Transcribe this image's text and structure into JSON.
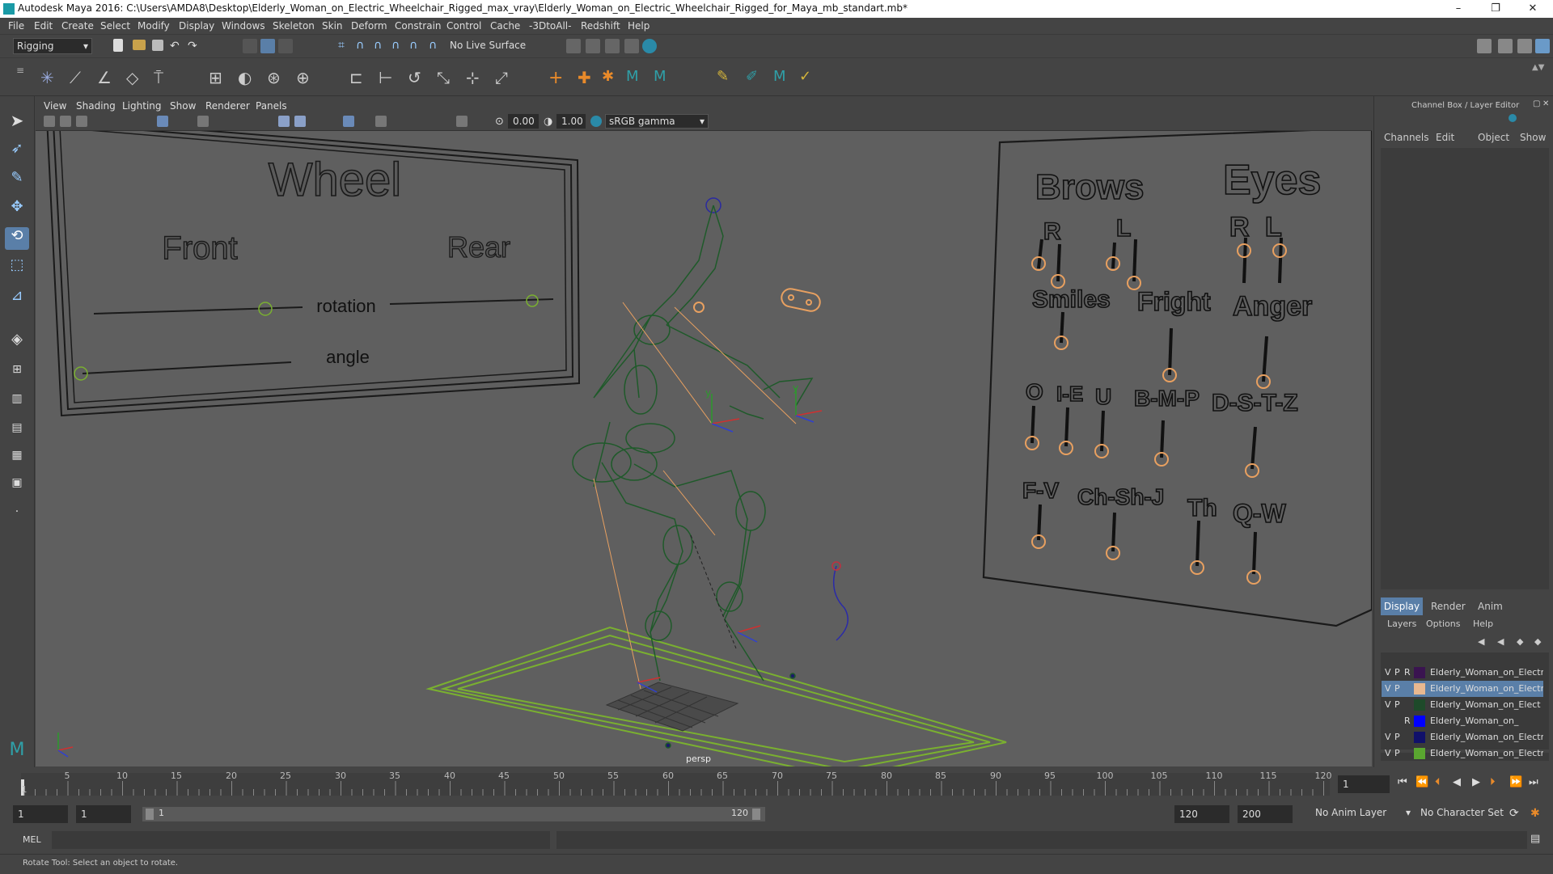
{
  "window": {
    "title": "Autodesk Maya 2016: C:\\Users\\AMDA8\\Desktop\\Elderly_Woman_on_Electric_Wheelchair_Rigged_max_vray\\Elderly_Woman_on_Electric_Wheelchair_Rigged_for_Maya_mb_standart.mb*",
    "minimize": "–",
    "restore": "❐",
    "close": "✕"
  },
  "menu": [
    "File",
    "Edit",
    "Create",
    "Select",
    "Modify",
    "Display",
    "Windows",
    "Skeleton",
    "Skin",
    "Deform",
    "Constrain",
    "Control",
    "Cache",
    "-3DtoAll-",
    "Redshift",
    "Help"
  ],
  "shelf": {
    "mode": "Rigging",
    "live_surface": "No Live Surface"
  },
  "panel_menu": [
    "View",
    "Shading",
    "Lighting",
    "Show",
    "Renderer",
    "Panels"
  ],
  "panel_toolbar": {
    "value_a": "0.00",
    "value_b": "1.00",
    "color_space": "sRGB gamma"
  },
  "viewport": {
    "camera": "persp",
    "wheel_board": {
      "title": "Wheel",
      "front": "Front",
      "rear": "Rear",
      "rotation": "rotation",
      "angle": "angle"
    },
    "face_board": {
      "brows": "Brows",
      "eyes": "Eyes",
      "brows_r": "R",
      "brows_l": "L",
      "eyes_r": "R",
      "eyes_l": "L",
      "smiles": "Smiles",
      "fright": "Fright",
      "anger": "Anger",
      "o": "O",
      "ie": "I-E",
      "u": "U",
      "bmp": "B-M-P",
      "dstz": "D-S-T-Z",
      "fv": "F-V",
      "chshj": "Ch-Sh-J",
      "th": "Th",
      "qw": "Q-W"
    }
  },
  "channel_box": {
    "header": "Channel Box / Layer Editor",
    "menu": [
      "Channels",
      "Edit",
      "Object",
      "Show"
    ],
    "tabs": [
      "Display",
      "Render",
      "Anim"
    ],
    "layer_menu": [
      "Layers",
      "Options",
      "Help"
    ],
    "layers": [
      {
        "v": "V",
        "p": "P",
        "r": "R",
        "color": "#3a1450",
        "name": "Elderly_Woman_on_Electri"
      },
      {
        "v": "V",
        "p": "P",
        "r": "",
        "color": "#e8b890",
        "name": "Elderly_Woman_on_Electri",
        "selected": true
      },
      {
        "v": "V",
        "p": "P",
        "r": "",
        "color": "#1e4a2a",
        "name": "Elderly_Woman_on_Elect"
      },
      {
        "v": "",
        "p": "",
        "r": "R",
        "color": "#0000ff",
        "name": "Elderly_Woman_on_"
      },
      {
        "v": "V",
        "p": "P",
        "r": "",
        "color": "#10106a",
        "name": "Elderly_Woman_on_Electri"
      },
      {
        "v": "V",
        "p": "P",
        "r": "",
        "color": "#5aa630",
        "name": "Elderly_Woman_on_Electri"
      }
    ]
  },
  "timeline": {
    "ticks": [
      "1",
      "5",
      "10",
      "15",
      "20",
      "25",
      "30",
      "35",
      "40",
      "45",
      "50",
      "55",
      "60",
      "65",
      "70",
      "75",
      "80",
      "85",
      "90",
      "95",
      "100",
      "105",
      "110",
      "115",
      "120"
    ],
    "current_frame": "1"
  },
  "range": {
    "start": "1",
    "start2": "1",
    "slider_start": "1",
    "slider_end": "120",
    "end": "120",
    "end2": "200",
    "anim_layer": "No Anim Layer",
    "char_set": "No Character Set"
  },
  "mel": {
    "label": "MEL"
  },
  "help": {
    "text": "Rotate Tool: Select an object to rotate."
  },
  "colors": {
    "rig_green": "#1f5a2a",
    "controller_orange": "#e8a060",
    "floor_green": "#7ab030"
  }
}
